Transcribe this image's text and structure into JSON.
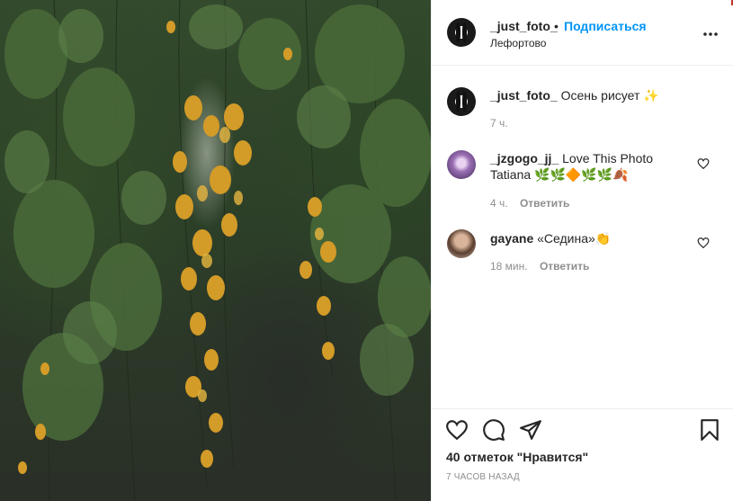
{
  "post": {
    "username": "_just_foto_",
    "dot": "•",
    "follow_label": "Подписаться",
    "location": "Лефортово",
    "caption": "Осень рисует",
    "caption_emoji": "✨",
    "caption_time": "7 ч."
  },
  "comments": [
    {
      "username": "_jzgogo_jj_",
      "text": "Love This Photo Tatiana",
      "emoji": "🌿🌿🔶🌿🌿🍂",
      "time": "4 ч.",
      "reply_label": "Ответить"
    },
    {
      "username": "gayane",
      "text": "«Седина»",
      "emoji": "👏",
      "time": "18 мин.",
      "reply_label": "Ответить"
    }
  ],
  "likes_text": "40 отметок \"Нравится\"",
  "time_ago": "7 часов назад",
  "icons": {
    "more": "more-options-icon",
    "like": "heart-icon",
    "comment": "comment-icon",
    "share": "share-icon",
    "save": "bookmark-icon"
  },
  "colors": {
    "accent": "#0095f6",
    "text": "#262626",
    "muted": "#8e8e8e",
    "border": "#efefef"
  }
}
